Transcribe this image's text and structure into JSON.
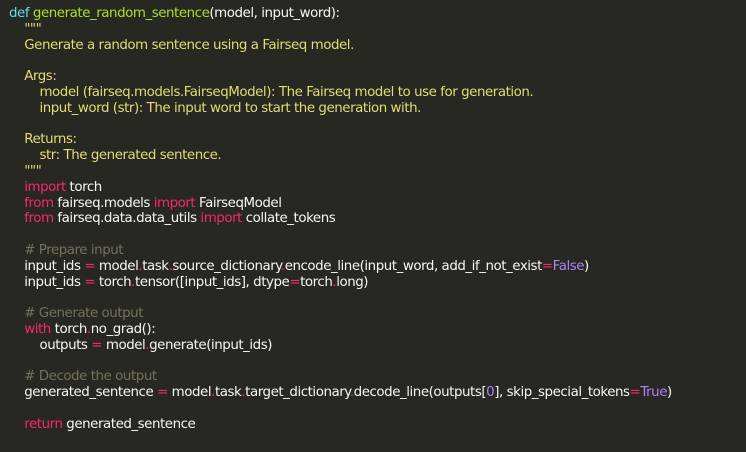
{
  "code": {
    "lines": [
      [
        {
          "t": "def",
          "c": "kw-def"
        },
        {
          "t": " ",
          "c": "txt"
        },
        {
          "t": "generate_random_sentence",
          "c": "fn"
        },
        {
          "t": "(model, input_word):",
          "c": "txt"
        }
      ],
      [
        {
          "t": "    \"\"\"",
          "c": "str"
        }
      ],
      [
        {
          "t": "    Generate a random sentence using a Fairseq model.",
          "c": "str"
        }
      ],
      [
        {
          "t": "",
          "c": "txt"
        }
      ],
      [
        {
          "t": "    Args:",
          "c": "str"
        }
      ],
      [
        {
          "t": "        model (fairseq.models.FairseqModel): The Fairseq model to use for generation.",
          "c": "str"
        }
      ],
      [
        {
          "t": "        input_word (str): The input word to start the generation with.",
          "c": "str"
        }
      ],
      [
        {
          "t": "",
          "c": "txt"
        }
      ],
      [
        {
          "t": "    Returns:",
          "c": "str"
        }
      ],
      [
        {
          "t": "        str: The generated sentence.",
          "c": "str"
        }
      ],
      [
        {
          "t": "    \"\"\"",
          "c": "str"
        }
      ],
      [
        {
          "t": "    ",
          "c": "txt"
        },
        {
          "t": "import",
          "c": "kw"
        },
        {
          "t": " torch",
          "c": "txt"
        }
      ],
      [
        {
          "t": "    ",
          "c": "txt"
        },
        {
          "t": "from",
          "c": "kw"
        },
        {
          "t": " fairseq.models ",
          "c": "txt"
        },
        {
          "t": "import",
          "c": "kw"
        },
        {
          "t": " FairseqModel",
          "c": "txt"
        }
      ],
      [
        {
          "t": "    ",
          "c": "txt"
        },
        {
          "t": "from",
          "c": "kw"
        },
        {
          "t": " fairseq.data.data_utils ",
          "c": "txt"
        },
        {
          "t": "import",
          "c": "kw"
        },
        {
          "t": " collate_tokens",
          "c": "txt"
        }
      ],
      [
        {
          "t": "",
          "c": "txt"
        }
      ],
      [
        {
          "t": "    # Prepare input",
          "c": "cmt"
        }
      ],
      [
        {
          "t": "    input_ids ",
          "c": "txt"
        },
        {
          "t": "=",
          "c": "op"
        },
        {
          "t": " model",
          "c": "txt"
        },
        {
          "t": ".",
          "c": "op"
        },
        {
          "t": "task",
          "c": "txt"
        },
        {
          "t": ".",
          "c": "op"
        },
        {
          "t": "source_dictionary",
          "c": "txt"
        },
        {
          "t": ".",
          "c": "op"
        },
        {
          "t": "encode_line(input_word, add_if_not_exist",
          "c": "txt"
        },
        {
          "t": "=",
          "c": "op"
        },
        {
          "t": "False",
          "c": "const"
        },
        {
          "t": ")",
          "c": "txt"
        }
      ],
      [
        {
          "t": "    input_ids ",
          "c": "txt"
        },
        {
          "t": "=",
          "c": "op"
        },
        {
          "t": " torch",
          "c": "txt"
        },
        {
          "t": ".",
          "c": "op"
        },
        {
          "t": "tensor([input_ids], dtype",
          "c": "txt"
        },
        {
          "t": "=",
          "c": "op"
        },
        {
          "t": "torch",
          "c": "txt"
        },
        {
          "t": ".",
          "c": "op"
        },
        {
          "t": "long)",
          "c": "txt"
        }
      ],
      [
        {
          "t": "",
          "c": "txt"
        }
      ],
      [
        {
          "t": "    # Generate output",
          "c": "cmt"
        }
      ],
      [
        {
          "t": "    ",
          "c": "txt"
        },
        {
          "t": "with",
          "c": "kw"
        },
        {
          "t": " torch",
          "c": "txt"
        },
        {
          "t": ".",
          "c": "op"
        },
        {
          "t": "no_grad():",
          "c": "txt"
        }
      ],
      [
        {
          "t": "        outputs ",
          "c": "txt"
        },
        {
          "t": "=",
          "c": "op"
        },
        {
          "t": " model",
          "c": "txt"
        },
        {
          "t": ".",
          "c": "op"
        },
        {
          "t": "generate(input_ids)",
          "c": "txt"
        }
      ],
      [
        {
          "t": "",
          "c": "txt"
        }
      ],
      [
        {
          "t": "    # Decode the output",
          "c": "cmt"
        }
      ],
      [
        {
          "t": "    generated_sentence ",
          "c": "txt"
        },
        {
          "t": "=",
          "c": "op"
        },
        {
          "t": " model",
          "c": "txt"
        },
        {
          "t": ".",
          "c": "op"
        },
        {
          "t": "task",
          "c": "txt"
        },
        {
          "t": ".",
          "c": "op"
        },
        {
          "t": "target_dictionary",
          "c": "txt"
        },
        {
          "t": ".",
          "c": "op"
        },
        {
          "t": "decode_line(outputs[",
          "c": "txt"
        },
        {
          "t": "0",
          "c": "num"
        },
        {
          "t": "], skip_special_tokens",
          "c": "txt"
        },
        {
          "t": "=",
          "c": "op"
        },
        {
          "t": "True",
          "c": "const"
        },
        {
          "t": ")",
          "c": "txt"
        }
      ],
      [
        {
          "t": "",
          "c": "txt"
        }
      ],
      [
        {
          "t": "    ",
          "c": "txt"
        },
        {
          "t": "return",
          "c": "kw"
        },
        {
          "t": " generated_sentence",
          "c": "txt"
        }
      ]
    ]
  }
}
